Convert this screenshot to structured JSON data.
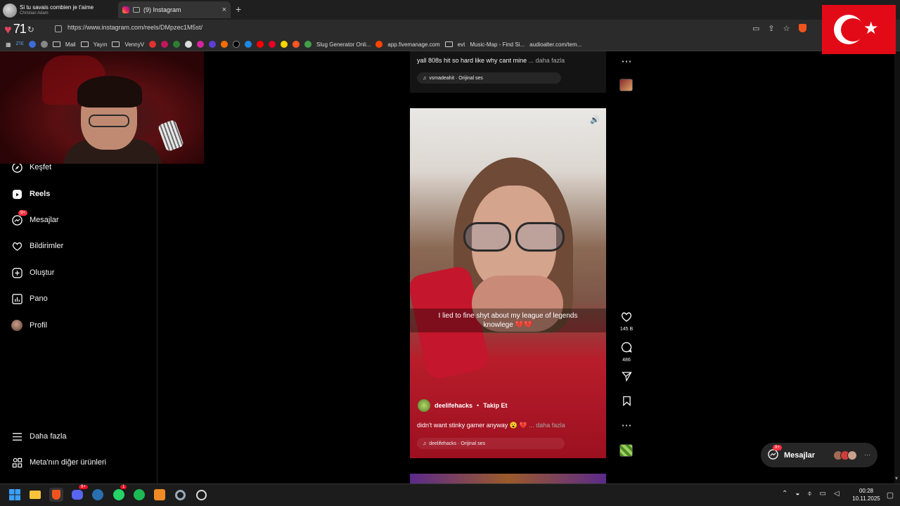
{
  "browser": {
    "media": {
      "title": "Si tu savais combien je t'aime",
      "artist": "Christian Adam"
    },
    "tab": {
      "title": "(9) Instagram"
    },
    "new_tab": "+",
    "close_tab": "×",
    "url": "https://www.instagram.com/reels/DMpzec1M5st/",
    "heart_count": "71",
    "bookmarks": [
      "Mail",
      "Yayın",
      "VennyV",
      "Slug Generator Onli...",
      "app.fivemanage.com",
      "evt",
      "Music-Map - Find Si...",
      "audioalter.com/tem..."
    ],
    "bookmark_prefix": "ZTE"
  },
  "sidebar": {
    "items": [
      {
        "label": "Keşfet"
      },
      {
        "label": "Reels"
      },
      {
        "label": "Mesajlar",
        "badge": "9+"
      },
      {
        "label": "Bildirimler"
      },
      {
        "label": "Oluştur"
      },
      {
        "label": "Pano"
      },
      {
        "label": "Profil"
      }
    ],
    "more": "Daha fazla",
    "meta": "Meta'nın diğer ürünleri"
  },
  "previous_reel": {
    "caption": "yall 808s hit so hard like why cant mine",
    "more": "... daha fazla",
    "audio": "vsmadeahit · Orijinal ses"
  },
  "reel": {
    "subtitle_line1": "I lied to fine shyt about my league of legends",
    "subtitle_line2": "knowlege 💔💔",
    "username": "deelifehacks",
    "dot": "•",
    "follow": "Takip Et",
    "caption": "didn't want stinky gamer anyway 😮 💔",
    "more": "... daha fazla",
    "audio": "deelifehacks · Orijinal ses"
  },
  "actions": {
    "likes": "145 B",
    "comments": "486"
  },
  "messages_float": {
    "label": "Mesajlar",
    "badge": "9+"
  },
  "taskbar": {
    "time": "00:28",
    "date": "10.11.2025",
    "discord_badge": "9+",
    "whatsapp_badge": "1"
  },
  "colors": {
    "accent_red": "#ff3040",
    "brave": "#f0541e",
    "flag_red": "#e30a17"
  }
}
